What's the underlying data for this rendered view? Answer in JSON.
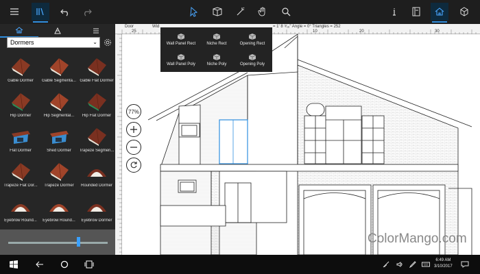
{
  "colors": {
    "accent": "#2f8fe0",
    "topbar": "#1e1e1e",
    "sidebar": "#262626",
    "taskbar": "#0d0d0d"
  },
  "toolbar": {
    "left": [
      "hamburger-icon",
      "library-icon",
      "undo-icon",
      "redo-icon"
    ],
    "center": [
      "select-cursor-icon",
      "3d-view-icon",
      "magic-select-icon",
      "pan-hand-icon",
      "search-icon"
    ],
    "right": [
      "info-icon",
      "notes-icon",
      "house-icon",
      "cube-icon"
    ]
  },
  "sidebar": {
    "tabs": [
      "dormer-tab",
      "texture-tab",
      "list-tab"
    ],
    "category": "Dormers",
    "items": [
      {
        "label": "Gable Dormer",
        "kind": "gable"
      },
      {
        "label": "Gable Segmenta...",
        "kind": "gable-seg"
      },
      {
        "label": "Gable Flat Dormer",
        "kind": "gable-flat"
      },
      {
        "label": "Hip Dormer",
        "kind": "hip"
      },
      {
        "label": "Hip Segmental...",
        "kind": "hip-seg"
      },
      {
        "label": "Hip Flat Dormer",
        "kind": "hip-flat"
      },
      {
        "label": "Flat Dormer",
        "kind": "flat"
      },
      {
        "label": "Shed Dormer",
        "kind": "shed"
      },
      {
        "label": "Trapeze Segmen...",
        "kind": "trapeze-seg"
      },
      {
        "label": "Trapeze Flat Dor...",
        "kind": "trapeze-flat"
      },
      {
        "label": "Trapeze Dormer",
        "kind": "trapeze"
      },
      {
        "label": "Rounded Dormer",
        "kind": "rounded"
      },
      {
        "label": "Eyebrow Round...",
        "kind": "eyebrow-1"
      },
      {
        "label": "Eyebrow Round...",
        "kind": "eyebrow-2"
      },
      {
        "label": "Eyebrow Dormer",
        "kind": "eyebrow-3"
      }
    ],
    "slider_value": 0.7
  },
  "ruler": {
    "info_left": "Door",
    "info_mid": "Wid",
    "info_right": "= 1' 8 ⁹⁄₁₆\"   Angle = 0°   Triangles = 252",
    "ticks": [
      "25",
      "20",
      "15",
      "10",
      "20",
      "30"
    ]
  },
  "zoom": {
    "value": "77%"
  },
  "context_menu": {
    "items": [
      "Wall Panel Rect",
      "Niche Rect",
      "Opening Rect",
      "Wall Panel Poly",
      "Niche Poly",
      "Opening Poly"
    ]
  },
  "watermark": "ColorMango.com",
  "taskbar": {
    "time": "6:49 AM",
    "date": "3/10/2017"
  }
}
